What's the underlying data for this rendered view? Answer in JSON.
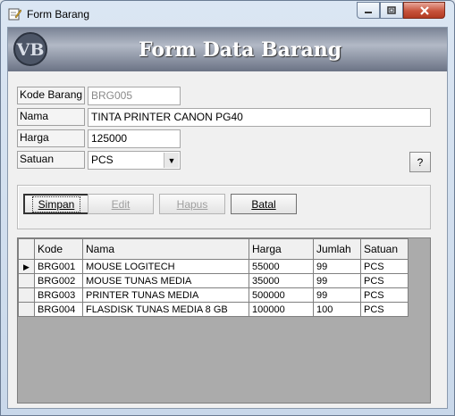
{
  "window": {
    "title": "Form Barang",
    "controls": [
      "minimize",
      "maximize",
      "close"
    ]
  },
  "banner": {
    "logo_text": "VB",
    "title": "Form Data Barang"
  },
  "form": {
    "kode": {
      "label": "Kode Barang",
      "value": "BRG005"
    },
    "nama": {
      "label": "Nama",
      "value": "TINTA PRINTER CANON PG40"
    },
    "harga": {
      "label": "Harga",
      "value": "125000"
    },
    "satuan": {
      "label": "Satuan",
      "value": "PCS"
    },
    "help_label": "?"
  },
  "buttons": {
    "simpan": {
      "label": "Simpan",
      "enabled": true
    },
    "edit": {
      "label": "Edit",
      "enabled": false
    },
    "hapus": {
      "label": "Hapus",
      "enabled": false
    },
    "batal": {
      "label": "Batal",
      "enabled": true
    }
  },
  "grid": {
    "columns": [
      "Kode",
      "Nama",
      "Harga",
      "Jumlah",
      "Satuan"
    ],
    "rows": [
      {
        "kode": "BRG001",
        "nama": "MOUSE LOGITECH",
        "harga": "55000",
        "jumlah": "99",
        "satuan": "PCS",
        "current": true
      },
      {
        "kode": "BRG002",
        "nama": "MOUSE TUNAS MEDIA",
        "harga": "35000",
        "jumlah": "99",
        "satuan": "PCS",
        "current": false
      },
      {
        "kode": "BRG003",
        "nama": "PRINTER TUNAS MEDIA",
        "harga": "500000",
        "jumlah": "99",
        "satuan": "PCS",
        "current": false
      },
      {
        "kode": "BRG004",
        "nama": "FLASDISK TUNAS MEDIA 8 GB",
        "harga": "100000",
        "jumlah": "100",
        "satuan": "PCS",
        "current": false
      }
    ]
  },
  "colors": {
    "banner_text": "#ffffff",
    "disabled_text": "#8a8a8a",
    "close_button": "#c7533c"
  }
}
